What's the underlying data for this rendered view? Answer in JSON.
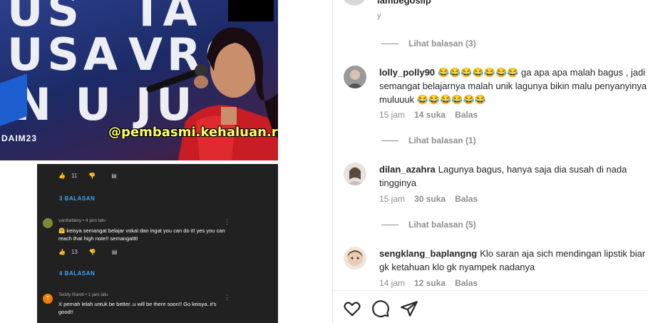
{
  "post": {
    "account": "lambegosiip"
  },
  "media": {
    "watermark": "@pembasmi.kehaluan.reall",
    "corner_tag": "DAIM23",
    "background_letters": [
      "US",
      "TA",
      "USA",
      "VRO",
      "N U",
      "JU"
    ],
    "yt": {
      "like_count_1": "11",
      "replies_1": "3 BALASAN",
      "comment_1_author": "vanlladaisy • 4 jam lalu",
      "comment_1_text": "🤗 keisya semangat belajar vokal dan ingat you can do it! yes you can reach that high note!! semangattt!",
      "like_count_2": "13",
      "replies_2": "4 BALASAN",
      "comment_2_author": "Teddy Ramli • 1 jam lalu",
      "comment_2_avatar_letter": "T",
      "comment_2_text": "X pernah lelah untuk be better..u will be there soon!! Go keisya..it's good!!"
    }
  },
  "comments": [
    {
      "username": "lolly_polly90",
      "text": "😂😂😂😂😂😂😂 ga apa apa malah bagus , jadi semangat belajarnya malah unik lagunya bikin malu penyanyinya muluuuk 😂😂😂😂😂😂",
      "time": "15 jam",
      "likes": "14 suka",
      "reply_label": "Balas",
      "view_replies": "Lihat balasan (1)"
    },
    {
      "username": "dilan_azahra",
      "text": "Lagunya bagus, hanya saja dia susah di nada tingginya",
      "time": "15 jam",
      "likes": "30 suka",
      "reply_label": "Balas",
      "view_replies": "Lihat balasan (5)"
    },
    {
      "username": "sengklang_baplangng",
      "text": "Klo saran aja sich mendingan lipstik biar gk ketahuan klo gk nyampek nadanya",
      "time": "14 jam",
      "likes": "12 suka",
      "reply_label": "Balas"
    }
  ],
  "first_view_replies": "Lihat balasan (3)",
  "icons": {
    "like": "heart-icon",
    "comment": "comment-bubble-icon",
    "share": "paper-plane-icon"
  },
  "colors": {
    "muted": "#8e8e8e",
    "text": "#262626",
    "watermark": "#ffff66",
    "yt_link": "#3ea6ff"
  }
}
